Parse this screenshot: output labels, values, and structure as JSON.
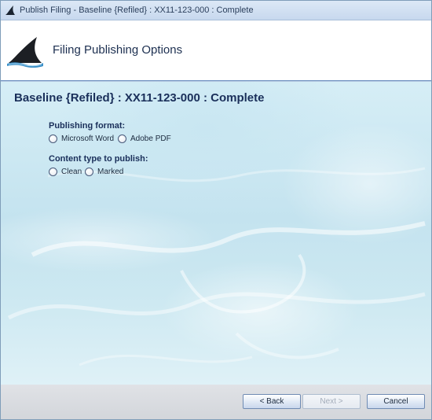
{
  "window": {
    "title": "Publish Filing - Baseline {Refiled} : XX11-123-000 : Complete"
  },
  "header": {
    "title": "Filing Publishing Options",
    "logo_icon": "shark-fin-icon"
  },
  "main": {
    "heading": "Baseline {Refiled} : XX11-123-000 : Complete",
    "publishing_format": {
      "label": "Publishing format:",
      "options": [
        {
          "label": "Microsoft Word",
          "selected": false
        },
        {
          "label": "Adobe PDF",
          "selected": false
        }
      ]
    },
    "content_type": {
      "label": "Content type to publish:",
      "options": [
        {
          "label": "Clean",
          "selected": false
        },
        {
          "label": "Marked",
          "selected": false
        }
      ]
    }
  },
  "footer": {
    "back_label": "< Back",
    "next_label": "Next >",
    "next_enabled": false,
    "cancel_label": "Cancel"
  },
  "colors": {
    "heading": "#1a2f5a",
    "header_separator": "#6b8fc0",
    "content_background": "#c4e3ef"
  }
}
